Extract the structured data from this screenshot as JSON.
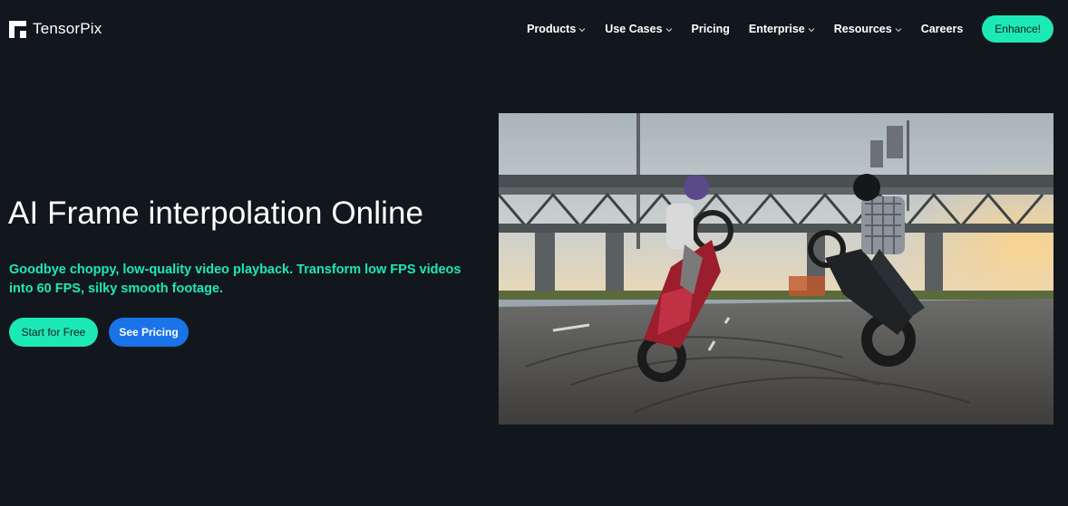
{
  "header": {
    "logo_text": "TensorPix",
    "nav": [
      {
        "label": "Products",
        "dropdown": true
      },
      {
        "label": "Use Cases",
        "dropdown": true
      },
      {
        "label": "Pricing",
        "dropdown": false
      },
      {
        "label": "Enterprise",
        "dropdown": true
      },
      {
        "label": "Resources",
        "dropdown": true
      },
      {
        "label": "Careers",
        "dropdown": false
      }
    ],
    "cta_label": "Enhance!"
  },
  "hero": {
    "title": "AI Frame interpolation Online",
    "subtitle": "Goodbye choppy, low-quality video playback. Transform low FPS videos into 60 FPS, silky smooth footage.",
    "primary_button": "Start for Free",
    "secondary_button": "See Pricing"
  },
  "media": {
    "description_icon": "video-preview-image"
  },
  "colors": {
    "background": "#12171d",
    "accent": "#1de9b6",
    "blue": "#1a73e8"
  }
}
